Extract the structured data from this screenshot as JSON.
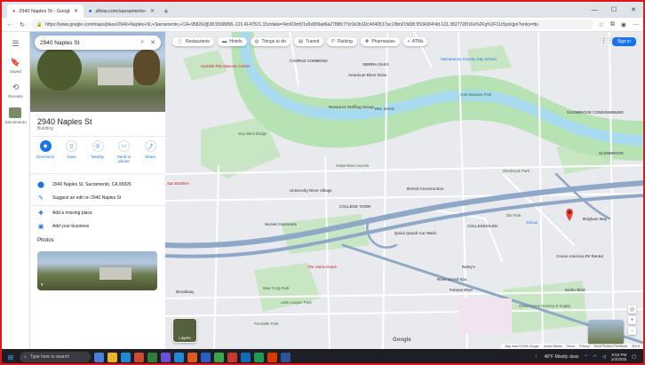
{
  "browser": {
    "tabs": [
      {
        "label": "2940 Naples St - Google Maps",
        "active": true
      },
      {
        "label": "zillow.com/sacramento-ca/rentals",
        "active": false
      }
    ],
    "url": "https://www.google.com/maps/place/2940+Naples+St,+Sacramento,+CA+95826/@38.5568958,-121.4147521,15z/data=!4m6!3m5!1s0x809ad6a2788fc77d:0x3b11fc4640517ac1!8m2!3d38.5534304!4d-121.3827728!16s%2Fg%2F11c5pckjpn?entry=ttu"
  },
  "search": {
    "value": "2940 Naples St"
  },
  "rail": {
    "items": [
      {
        "label": "Saved"
      },
      {
        "label": "Recents"
      },
      {
        "label": "Sacramento"
      }
    ]
  },
  "place": {
    "title": "2940 Naples St",
    "category": "Building",
    "actions": [
      {
        "label": "Directions"
      },
      {
        "label": "Save"
      },
      {
        "label": "Nearby"
      },
      {
        "label": "Send to phone"
      },
      {
        "label": "Share"
      }
    ],
    "address": "2940 Naples St, Sacramento, CA 95826",
    "suggest_edit": "Suggest an edit on 2940 Naples St",
    "add_missing": "Add a missing place",
    "add_business": "Add your business",
    "photos_title": "Photos"
  },
  "map": {
    "chips": [
      {
        "label": "Restaurants",
        "icon": "fork-knife"
      },
      {
        "label": "Hotels",
        "icon": "bed"
      },
      {
        "label": "Things to do",
        "icon": "camera"
      },
      {
        "label": "Transit",
        "icon": "bus"
      },
      {
        "label": "Parking",
        "icon": "parking"
      },
      {
        "label": "Pharmacies",
        "icon": "pill"
      },
      {
        "label": "ATMs",
        "icon": "atm"
      }
    ],
    "sign_in": "Sign in",
    "layers_label": "Layers",
    "logo": "Google",
    "footer": [
      "Map data ©2025 Google",
      "United States",
      "Terms",
      "Privacy",
      "Send Product Feedback",
      "500 ft"
    ],
    "labels": {
      "campus_commons": "CAMPUS COMMONS",
      "sierra_oaks": "SIERRA OAKS",
      "del_dayo": "DEL DAYO",
      "college_town": "COLLEGE TOWN",
      "college_glen": "COLLEGE/GLEN",
      "glenbrook": "GLENBROOK CONDOMINIUMS",
      "glenbrook2": "GLENBROOK",
      "scottish_rite": "Scottish Rite Masonic Center",
      "sacramento_country_day": "Sacramento Country Day School",
      "american_river_drive": "American River Drive",
      "oak_meadow": "Oak Meadow Park",
      "resource_staffing": "Resource Staffing Group",
      "guy_west": "Guy West Bridge",
      "howe_river_access": "Howe River Access",
      "glenbrook_park": "Glenbrook Park",
      "university_river_village": "University River Village",
      "bristol_construction": "Bristol Construction",
      "homet_commons": "Hornet Commons",
      "quick_quack": "Quick Quack Car Wash",
      "home_depot": "The Home Depot",
      "raleys": "Raley's",
      "rose_island_spa": "Rose Island Spa",
      "folsom_blvd": "Folsom Blvd",
      "mae_fong": "Mae Fong Park",
      "little_league": "Little League Park",
      "green_acres": "Green Acres Nursery & Supply",
      "cruise_america": "Cruise America RV Rental",
      "kiefer_blvd": "Kiefer Blvd",
      "brigham_way": "Brigham Way",
      "broadway": "Broadway",
      "ponsielle": "Ponsielle Park",
      "san_brothers": "San Brothers",
      "school": "School",
      "dix_park": "Dix Park"
    }
  },
  "taskbar": {
    "search_placeholder": "Type here to search",
    "weather": "46°F  Mostly clear",
    "time": "8:53 PM",
    "date": "1/4/2025"
  },
  "colors": {
    "river": "#a8dbf0",
    "park": "#c8e6c3",
    "freeway": "#8fa8c8",
    "accent": "#1a73e8",
    "pin": "#ea4335"
  }
}
